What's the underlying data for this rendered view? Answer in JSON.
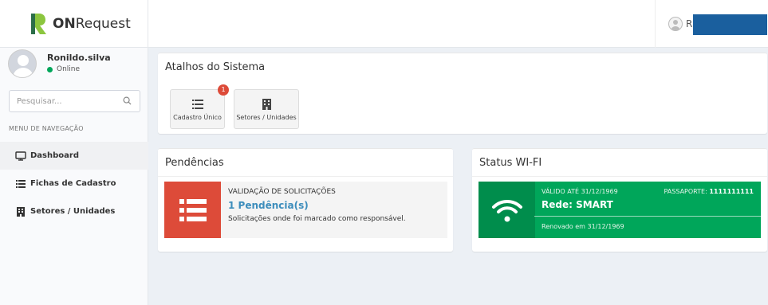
{
  "brand": {
    "name_bold": "ON",
    "name_rest": "Request"
  },
  "topbar": {
    "user_initial": "R"
  },
  "sidebar": {
    "user_name": "Ronildo.silva",
    "status": "Online",
    "search_placeholder": "Pesquisar...",
    "menu_header": "MENU DE NAVEGAÇÃO",
    "items": [
      {
        "label": "Dashboard",
        "icon": "monitor-icon",
        "active": true
      },
      {
        "label": "Fichas de Cadastro",
        "icon": "list-icon",
        "active": false
      },
      {
        "label": "Setores / Unidades",
        "icon": "building-icon",
        "active": false
      }
    ]
  },
  "shortcuts": {
    "title": "Atalhos do Sistema",
    "items": [
      {
        "label": "Cadastro Único",
        "icon": "list-icon",
        "badge": "1"
      },
      {
        "label": "Setores / Unidades",
        "icon": "building-icon",
        "badge": ""
      }
    ]
  },
  "pendencias": {
    "title": "Pendências",
    "label": "VALIDAÇÃO DE SOLICITAÇÕES",
    "count": "1 Pendência(s)",
    "description": "Solicitações onde foi marcado como responsável.",
    "icon": "list-icon"
  },
  "wifi": {
    "title": "Status WI-FI",
    "valid_until": "VÁLIDO ATÉ 31/12/1969",
    "passport_label": "PASSAPORTE:",
    "passport_value": "1111111111",
    "network": "Rede: SMART",
    "renewed": "Renovado em 31/12/1969",
    "icon": "wifi-icon"
  },
  "colors": {
    "accent_red": "#dd4b39",
    "accent_green": "#00a65a",
    "link_blue": "#3c8dbc",
    "online_green": "#00a65a"
  }
}
